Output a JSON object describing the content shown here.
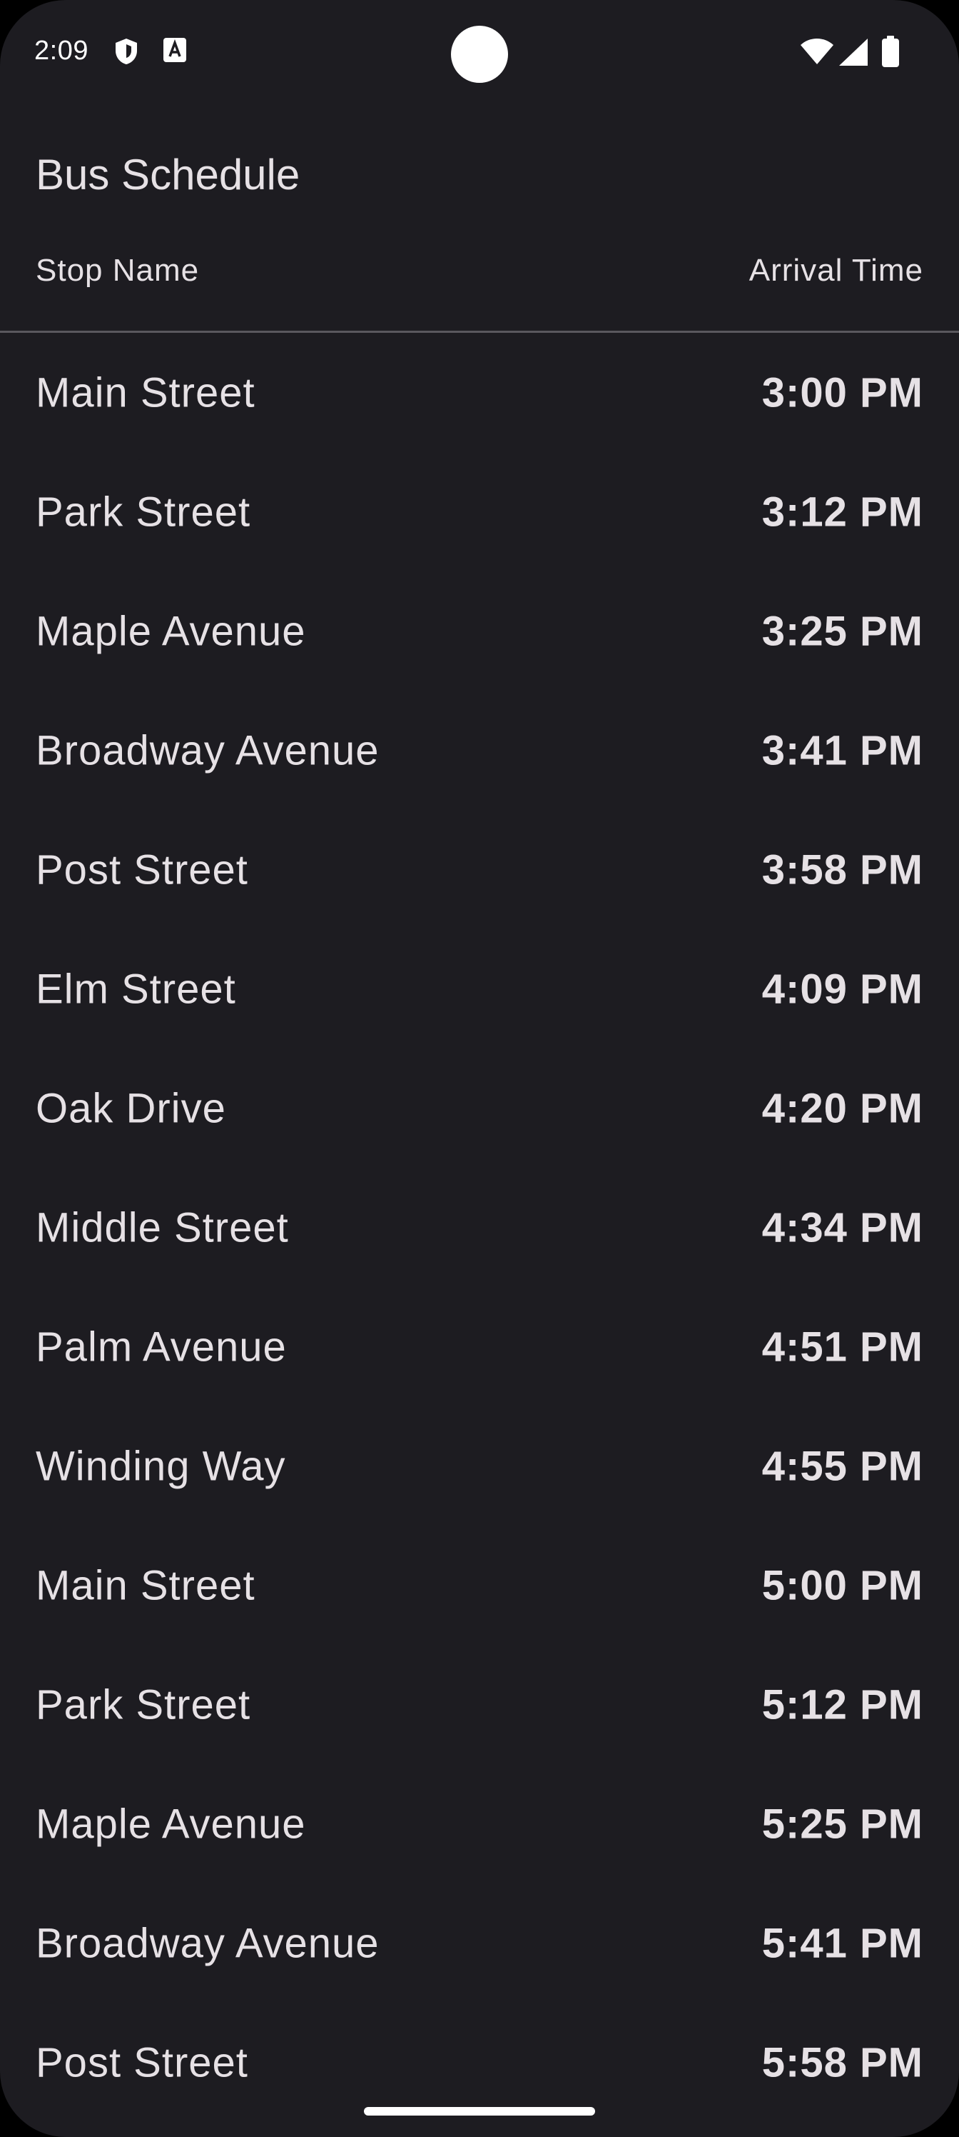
{
  "status_bar": {
    "time": "2:09",
    "icons": [
      "shield-icon",
      "a-icon",
      "wifi-icon",
      "signal-icon",
      "battery-icon"
    ]
  },
  "app": {
    "title": "Bus Schedule"
  },
  "table": {
    "headers": {
      "stop": "Stop Name",
      "time": "Arrival Time"
    },
    "rows": [
      {
        "stop": "Main Street",
        "time": "3:00 PM"
      },
      {
        "stop": "Park Street",
        "time": "3:12 PM"
      },
      {
        "stop": "Maple Avenue",
        "time": "3:25 PM"
      },
      {
        "stop": "Broadway Avenue",
        "time": "3:41 PM"
      },
      {
        "stop": "Post Street",
        "time": "3:58 PM"
      },
      {
        "stop": "Elm Street",
        "time": "4:09 PM"
      },
      {
        "stop": "Oak Drive",
        "time": "4:20 PM"
      },
      {
        "stop": "Middle Street",
        "time": "4:34 PM"
      },
      {
        "stop": "Palm Avenue",
        "time": "4:51 PM"
      },
      {
        "stop": "Winding Way",
        "time": "4:55 PM"
      },
      {
        "stop": "Main Street",
        "time": "5:00 PM"
      },
      {
        "stop": "Park Street",
        "time": "5:12 PM"
      },
      {
        "stop": "Maple Avenue",
        "time": "5:25 PM"
      },
      {
        "stop": "Broadway Avenue",
        "time": "5:41 PM"
      },
      {
        "stop": "Post Street",
        "time": "5:58 PM"
      }
    ]
  },
  "colors": {
    "background": "#1d1c21",
    "text": "#e6e1e5",
    "divider": "#5a585e"
  }
}
